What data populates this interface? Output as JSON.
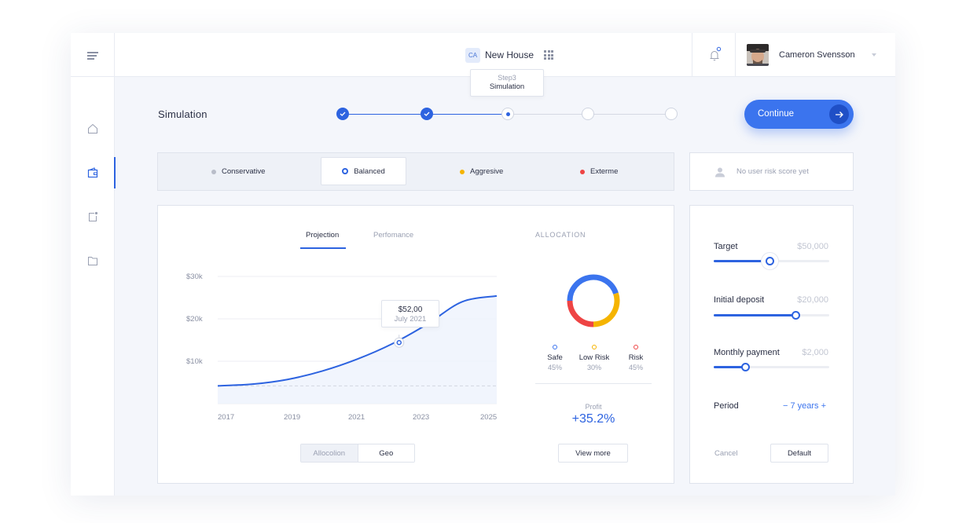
{
  "header": {
    "project_badge": "CA",
    "project_name": "New House",
    "user_name": "Cameron Svensson"
  },
  "page": {
    "title": "Simulation",
    "current_step_caption": "Step3",
    "current_step_name": "Simulation",
    "continue_label": "Continue"
  },
  "stepper": {
    "total_steps": 5,
    "completed_steps": 2,
    "current_step": 3
  },
  "risk_profiles": {
    "options": [
      {
        "label": "Conservative",
        "color": "#b9bdc9"
      },
      {
        "label": "Balanced",
        "color": "#2d63e0"
      },
      {
        "label": "Aggresive",
        "color": "#f5b400"
      },
      {
        "label": "Exterme",
        "color": "#ee4444"
      }
    ],
    "selected": "Balanced",
    "user_score_text": "No user risk score yet"
  },
  "chart_panel": {
    "tabs": [
      "Projection",
      "Perfomance"
    ],
    "active_tab": "Projection",
    "tooltip_value": "$52,00",
    "tooltip_date": "July 2021",
    "switch_options": [
      "Allocolion",
      "Geo"
    ],
    "active_switch": "Geo"
  },
  "chart_data": {
    "type": "area",
    "x_ticks": [
      "2017",
      "2019",
      "2021",
      "2023",
      "2025"
    ],
    "y_ticks": [
      "$30k",
      "$20k",
      "$10k"
    ],
    "ylim": [
      0,
      30000
    ],
    "xlim": [
      2017,
      2025
    ],
    "grid": true,
    "series": [
      {
        "values": [
          [
            2017,
            4200
          ],
          [
            2018,
            4600
          ],
          [
            2019,
            5700
          ],
          [
            2020,
            7700
          ],
          [
            2021,
            10500
          ],
          [
            2022,
            14100
          ],
          [
            2023,
            18700
          ],
          [
            2024,
            24000
          ],
          [
            2025,
            25400
          ]
        ]
      }
    ],
    "baseline": 4200,
    "highlight": {
      "x": 2022.2,
      "y": 14400
    }
  },
  "allocation": {
    "title": "ALLOCATION",
    "segments": [
      {
        "label": "Safe",
        "pct": "45%",
        "value": 45,
        "color": "#3b74ee"
      },
      {
        "label": "Low Risk",
        "pct": "30%",
        "value": 30,
        "color": "#f5b400"
      },
      {
        "label": "Risk",
        "pct": "45%",
        "value": 25,
        "color": "#ee4444"
      }
    ],
    "profit_label": "Profit",
    "profit_value": "+35.2%",
    "view_more_label": "View more"
  },
  "settings": {
    "target_label": "Target",
    "target_value": "$50,000",
    "target_fraction": 0.48,
    "deposit_label": "Initial deposit",
    "deposit_value": "$20,000",
    "deposit_fraction": 0.71,
    "monthly_label": "Monthly payment",
    "monthly_value": "$2,000",
    "monthly_fraction": 0.27,
    "period_label": "Period",
    "period_value": "−  7 years  +",
    "cancel_label": "Cancel",
    "default_label": "Default"
  },
  "colors": {
    "accent": "#2d63e0",
    "button": "#3b74ee"
  }
}
